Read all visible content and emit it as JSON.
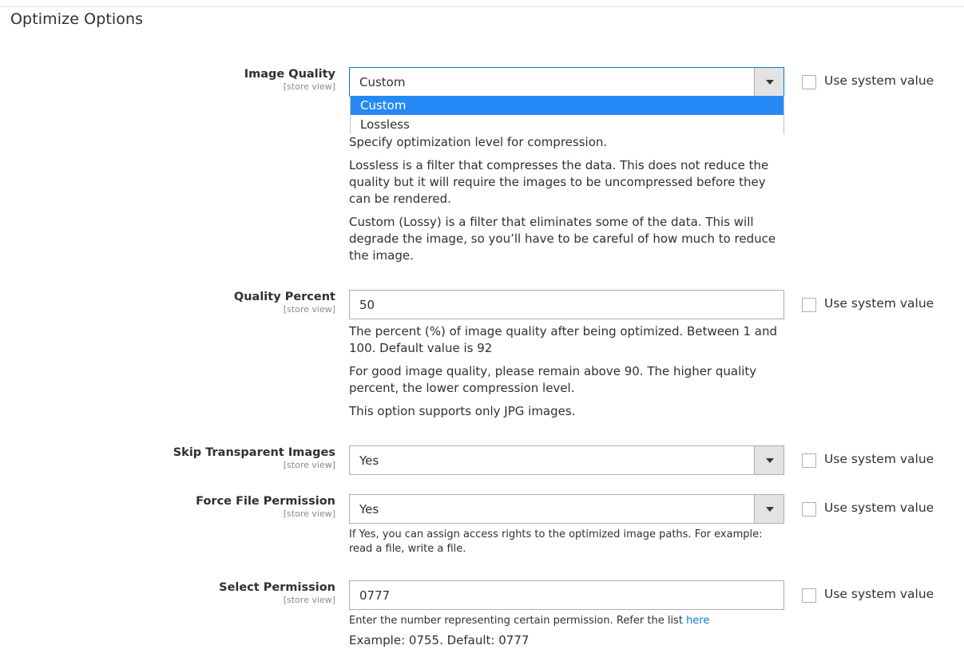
{
  "section": {
    "title": "Optimize Options"
  },
  "use_system_value_label": "Use system value",
  "fields": {
    "image_quality": {
      "label": "Image Quality",
      "scope": "[store view]",
      "value": "Custom",
      "options": [
        "Custom",
        "Lossless"
      ],
      "notes": [
        "Specify optimization level for compression.",
        "Lossless is a filter that compresses the data. This does not reduce the quality but it will require the images to be uncompressed before they can be rendered.",
        "Custom (Lossy) is a filter that eliminates some of the data. This will degrade the image, so you’ll have to be careful of how much to reduce the image."
      ]
    },
    "quality_percent": {
      "label": "Quality Percent",
      "scope": "[store view]",
      "value": "50",
      "notes": [
        "The percent (%) of image quality after being optimized. Between 1 and 100. Default value is 92",
        "For good image quality, please remain above 90. The higher quality percent, the lower compression level.",
        "This option supports only JPG images."
      ]
    },
    "skip_transparent": {
      "label": "Skip Transparent Images",
      "scope": "[store view]",
      "value": "Yes"
    },
    "force_permission": {
      "label": "Force File Permission",
      "scope": "[store view]",
      "value": "Yes",
      "note": "If Yes, you can assign access rights to the optimized image paths. For example: read a file, write a file."
    },
    "select_permission": {
      "label": "Select Permission",
      "scope": "[store view]",
      "value": "0777",
      "note_prefix": "Enter the number representing certain permission. Refer the list ",
      "note_link": "here",
      "example": "Example: 0755. Default: 0777"
    }
  }
}
